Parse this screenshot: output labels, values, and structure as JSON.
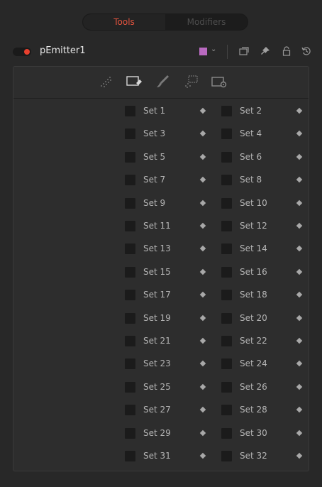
{
  "tabs": [
    {
      "label": "Tools",
      "active": true
    },
    {
      "label": "Modifiers",
      "active": false
    }
  ],
  "tool": {
    "name": "pEmitter1",
    "enabled": true,
    "color": "#b96ac0"
  },
  "header_icons": [
    "view-icon",
    "pin-icon",
    "lock-icon",
    "reset-icon"
  ],
  "panel_tabs": [
    {
      "name": "controls-tab",
      "icon": "particles-icon",
      "active": false
    },
    {
      "name": "sets-tab",
      "icon": "sets-icon",
      "active": true
    },
    {
      "name": "style-tab",
      "icon": "brush-icon",
      "active": false
    },
    {
      "name": "region-tab",
      "icon": "region-icon",
      "active": false
    },
    {
      "name": "settings-tab",
      "icon": "gear-icon",
      "active": false
    }
  ],
  "sets": [
    {
      "left": "Set 1",
      "right": "Set 2"
    },
    {
      "left": "Set 3",
      "right": "Set 4"
    },
    {
      "left": "Set 5",
      "right": "Set 6"
    },
    {
      "left": "Set 7",
      "right": "Set 8"
    },
    {
      "left": "Set 9",
      "right": "Set 10"
    },
    {
      "left": "Set 11",
      "right": "Set 12"
    },
    {
      "left": "Set 13",
      "right": "Set 14"
    },
    {
      "left": "Set 15",
      "right": "Set 16"
    },
    {
      "left": "Set 17",
      "right": "Set 18"
    },
    {
      "left": "Set 19",
      "right": "Set 20"
    },
    {
      "left": "Set 21",
      "right": "Set 22"
    },
    {
      "left": "Set 23",
      "right": "Set 24"
    },
    {
      "left": "Set 25",
      "right": "Set 26"
    },
    {
      "left": "Set 27",
      "right": "Set 28"
    },
    {
      "left": "Set 29",
      "right": "Set 30"
    },
    {
      "left": "Set 31",
      "right": "Set 32"
    }
  ],
  "colors": {
    "accent": "#e8402e",
    "background": "#282828",
    "panel": "#2d2d2d"
  }
}
